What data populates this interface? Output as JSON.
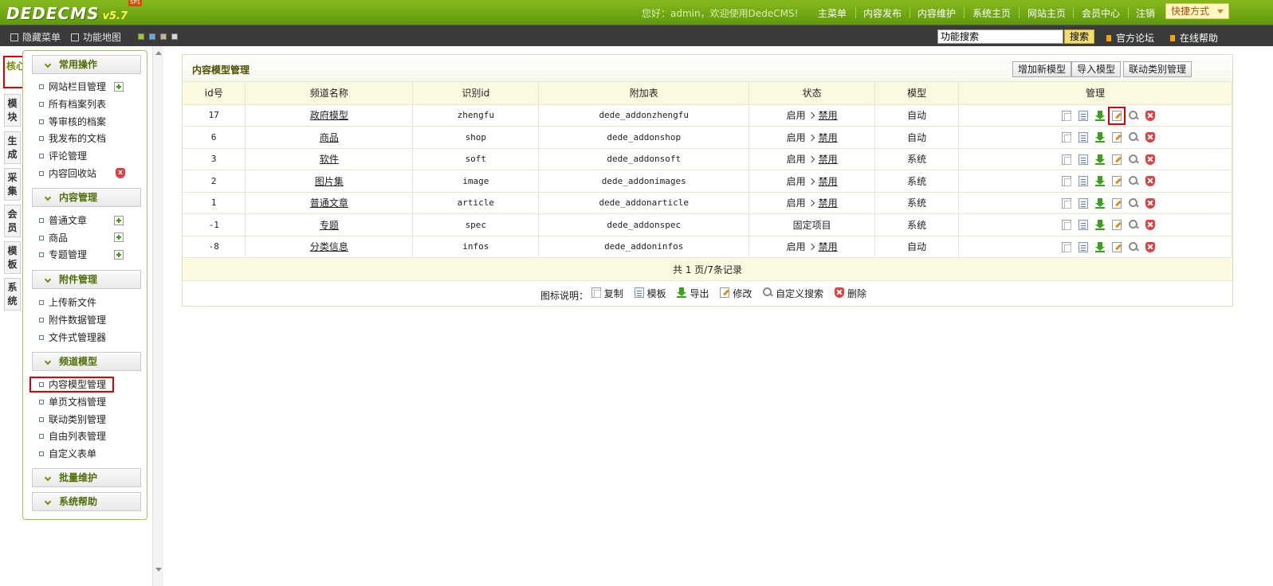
{
  "app": {
    "logo_text": "DEDECMS",
    "version": "v5.7",
    "edition": "SP1"
  },
  "header": {
    "welcome_prefix": "您好：",
    "user": "admin",
    "welcome_suffix": "，欢迎使用DedeCMS!",
    "nav": [
      "主菜单",
      "内容发布",
      "内容维护",
      "系统主页",
      "网站主页",
      "会员中心",
      "注销"
    ],
    "shortcut": "快捷方式"
  },
  "subbar": {
    "hide_menu": "隐藏菜单",
    "function_map": "功能地图",
    "search_value": "功能搜索",
    "search_button": "搜索",
    "forum": "官方论坛",
    "help": "在线帮助"
  },
  "left_tabs": [
    "核心",
    "模块",
    "生成",
    "采集",
    "会员",
    "模板",
    "系统"
  ],
  "sidebar": {
    "groups": [
      {
        "title": "常用操作",
        "items": [
          "网站栏目管理",
          "所有档案列表",
          "等审核的档案",
          "我发布的文档",
          "评论管理",
          "内容回收站"
        ]
      },
      {
        "title": "内容管理",
        "items": [
          "普通文章",
          "商品",
          "专题管理"
        ]
      },
      {
        "title": "附件管理",
        "items": [
          "上传新文件",
          "附件数据管理",
          "文件式管理器"
        ]
      },
      {
        "title": "频道模型",
        "items": [
          "内容模型管理",
          "单页文档管理",
          "联动类别管理",
          "自由列表管理",
          "自定义表单"
        ]
      },
      {
        "title": "批量维护",
        "items": []
      },
      {
        "title": "系统帮助",
        "items": []
      }
    ]
  },
  "panel": {
    "title": "内容模型管理",
    "buttons": [
      "增加新模型",
      "导入模型",
      "联动类别管理"
    ],
    "columns": [
      "id号",
      "频道名称",
      "识别id",
      "附加表",
      "状态",
      "模型",
      "管理"
    ],
    "rows": [
      {
        "id": "17",
        "name": "政府模型",
        "nid": "zhengfu",
        "table": "dede_addonzhengfu",
        "status": "启用",
        "action": "禁用",
        "model": "自动"
      },
      {
        "id": "6",
        "name": "商品",
        "nid": "shop",
        "table": "dede_addonshop",
        "status": "启用",
        "action": "禁用",
        "model": "自动"
      },
      {
        "id": "3",
        "name": "软件",
        "nid": "soft",
        "table": "dede_addonsoft",
        "status": "启用",
        "action": "禁用",
        "model": "系统"
      },
      {
        "id": "2",
        "name": "图片集",
        "nid": "image",
        "table": "dede_addonimages",
        "status": "启用",
        "action": "禁用",
        "model": "系统"
      },
      {
        "id": "1",
        "name": "普通文章",
        "nid": "article",
        "table": "dede_addonarticle",
        "status": "启用",
        "action": "禁用",
        "model": "系统"
      },
      {
        "id": "-1",
        "name": "专题",
        "nid": "spec",
        "table": "dede_addonspec",
        "status": "固定项目",
        "action": "",
        "model": "系统"
      },
      {
        "id": "-8",
        "name": "分类信息",
        "nid": "infos",
        "table": "dede_addoninfos",
        "status": "启用",
        "action": "禁用",
        "model": "自动"
      }
    ],
    "pager": "共 1 页/7条记录",
    "legend_label": "图标说明：",
    "legend": [
      "复制",
      "模板",
      "导出",
      "修改",
      "自定义搜索",
      "删除"
    ]
  },
  "colors": {
    "header_green": "#6fa614",
    "subbar_dark": "#3b3b3b",
    "highlight_red": "#e00000",
    "table_header_bg": "#fbfae1"
  }
}
